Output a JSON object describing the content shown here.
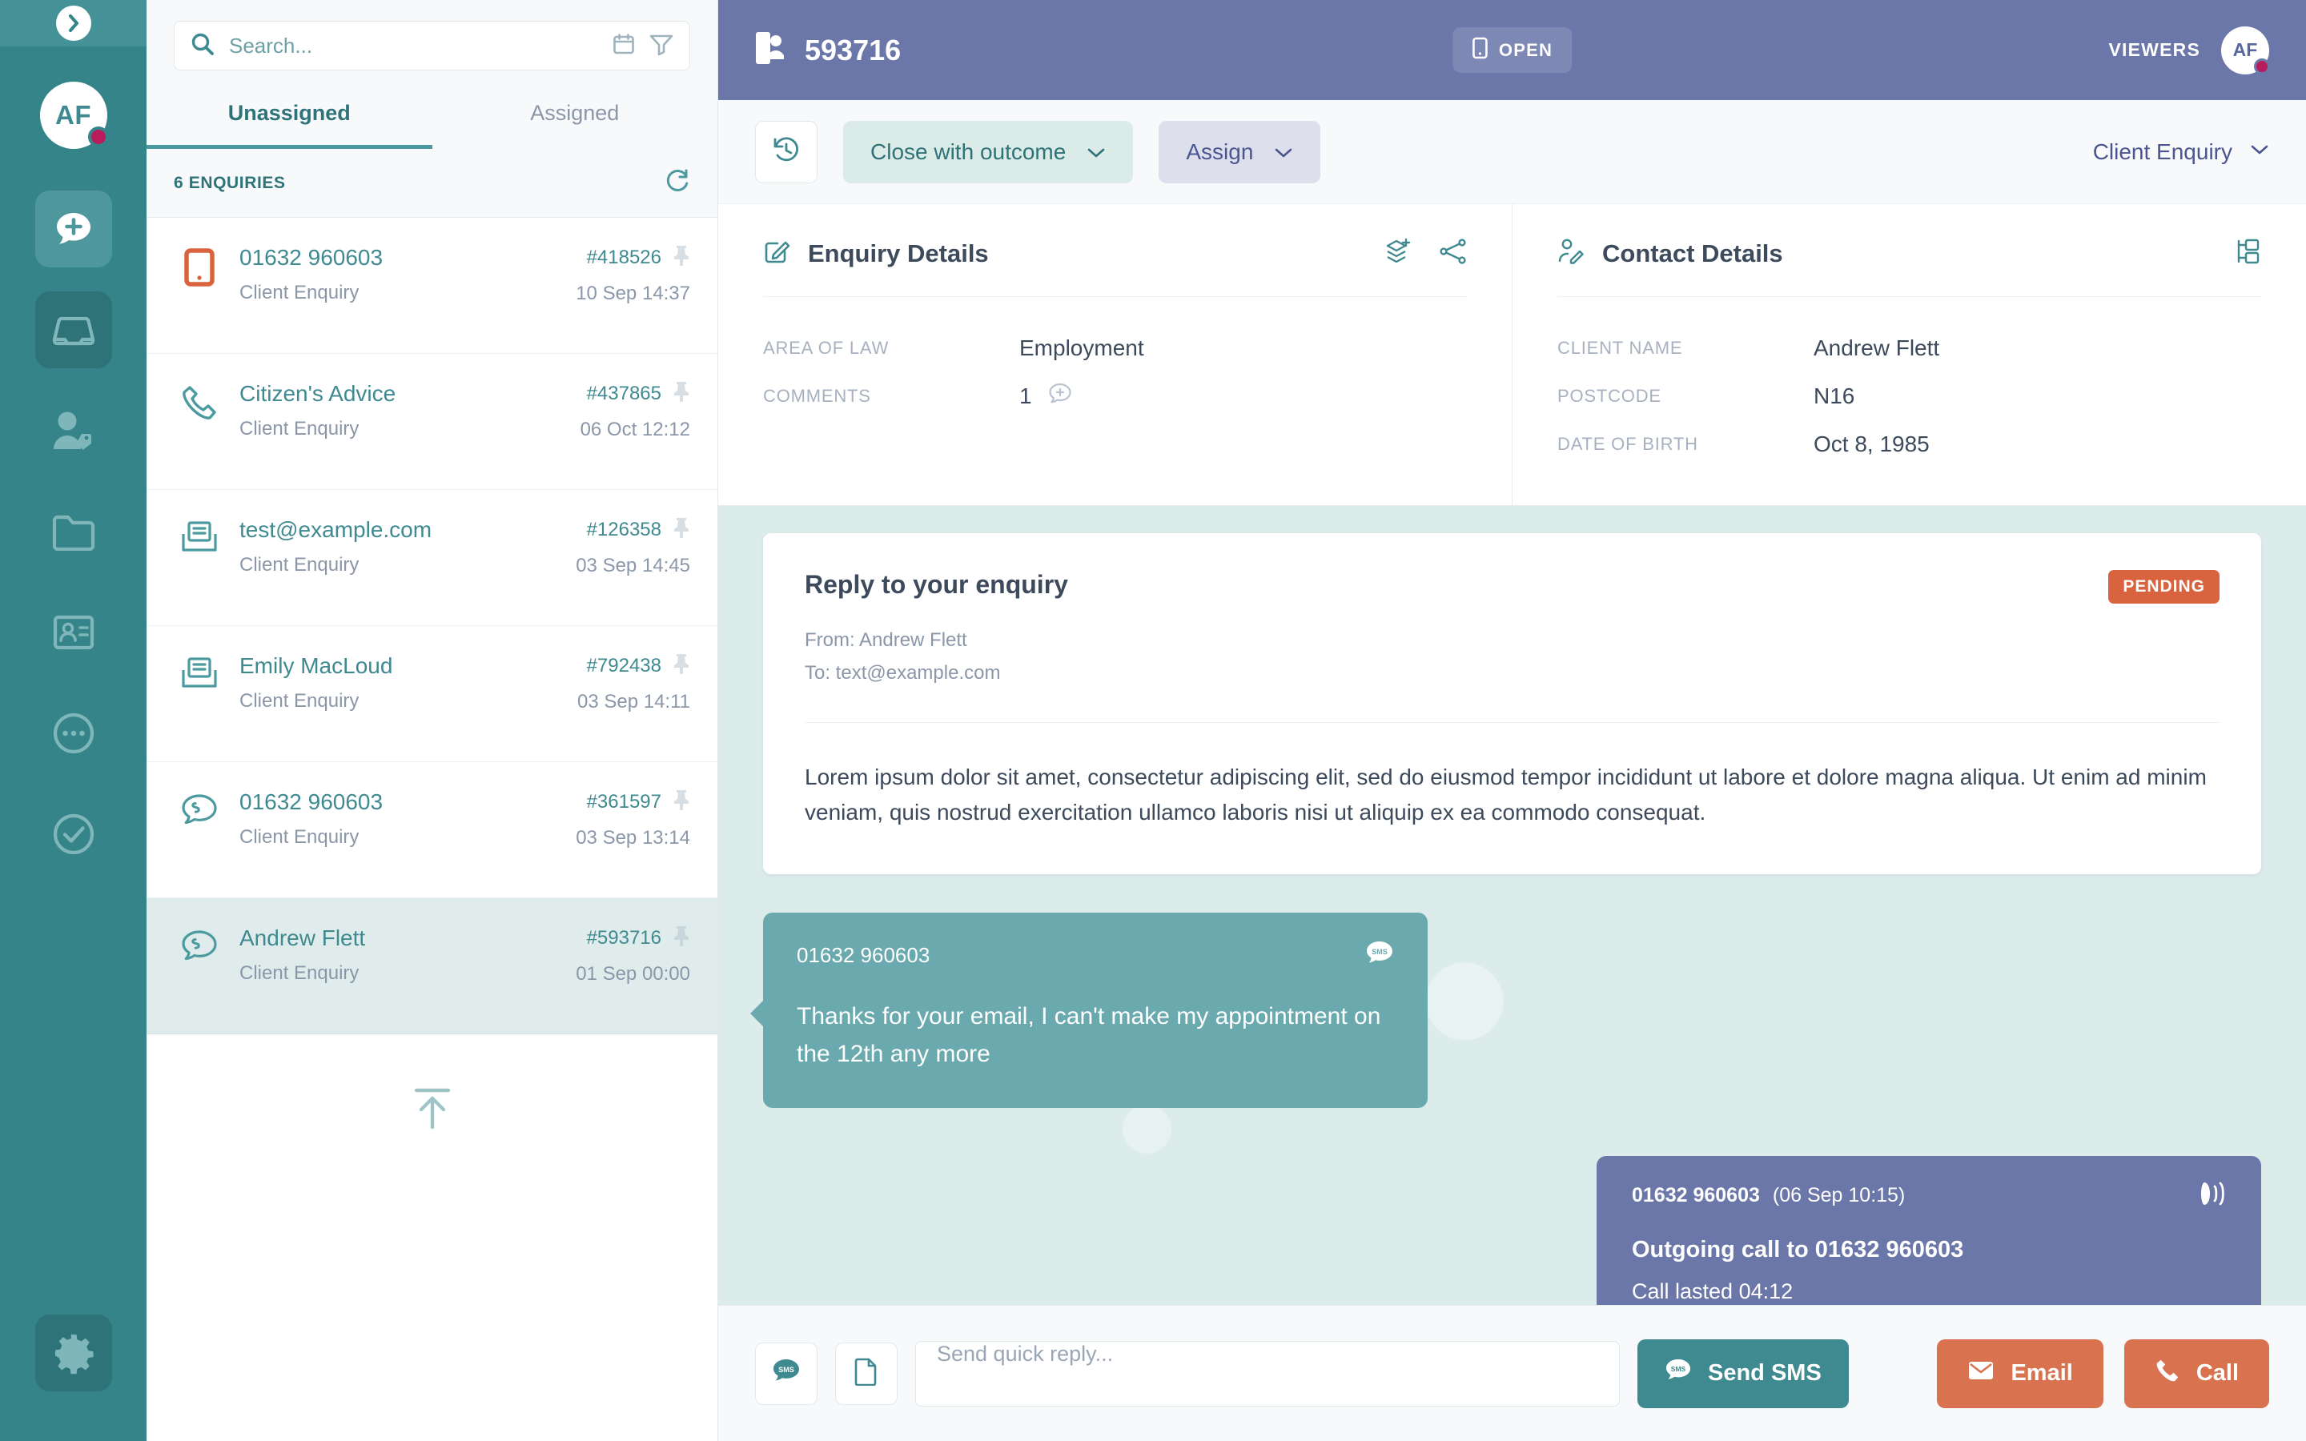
{
  "rail": {
    "collapse_icon": "chevron-right-icon",
    "avatar_initials": "AF",
    "items": [
      {
        "name": "new-enquiry",
        "icon": "chat-plus-icon",
        "active": false
      },
      {
        "name": "inbox",
        "icon": "inbox-tray-icon",
        "active": true
      },
      {
        "name": "contacts-tags",
        "icon": "person-tag-icon",
        "active": false
      },
      {
        "name": "folders",
        "icon": "folder-icon",
        "active": false
      },
      {
        "name": "contact-card",
        "icon": "contact-card-icon",
        "active": false
      },
      {
        "name": "more",
        "icon": "ellipsis-circle-icon",
        "active": false
      },
      {
        "name": "completed",
        "icon": "check-circle-icon",
        "active": false
      }
    ],
    "settings_icon": "gear-icon"
  },
  "list": {
    "search_placeholder": "Search...",
    "search_value": "",
    "search_icon": "search-icon",
    "calendar_icon": "calendar-icon",
    "filter_icon": "filter-funnel-icon",
    "refresh_icon": "refresh-icon",
    "tabs": [
      {
        "label": "Unassigned",
        "active": true
      },
      {
        "label": "Assigned",
        "active": false
      }
    ],
    "count_label": "6 ENQUIRIES",
    "upload_icon": "upload-arrow-icon",
    "rows": [
      {
        "icon": "mobile-phone-icon",
        "icon_color": "#d9633f",
        "title": "01632 960603",
        "subtitle": "Client Enquiry",
        "id": "#418526",
        "date": "10 Sep 14:37",
        "pin_icon": "pin-icon",
        "selected": false
      },
      {
        "icon": "phone-handset-icon",
        "icon_color": "#4b9aa0",
        "title": "Citizen's Advice",
        "subtitle": "Client Enquiry",
        "id": "#437865",
        "date": "06 Oct 12:12",
        "pin_icon": "pin-icon",
        "selected": false
      },
      {
        "icon": "open-envelope-icon",
        "icon_color": "#4b9aa0",
        "title": "test@example.com",
        "subtitle": "Client Enquiry",
        "id": "#126358",
        "date": "03 Sep 14:45",
        "pin_icon": "pin-icon",
        "selected": false
      },
      {
        "icon": "open-envelope-icon",
        "icon_color": "#4b9aa0",
        "title": "Emily MacLoud",
        "subtitle": "Client Enquiry",
        "id": "#792438",
        "date": "03 Sep 14:11",
        "pin_icon": "pin-icon",
        "selected": false
      },
      {
        "icon": "sms-chat-icon",
        "icon_color": "#4b9aa0",
        "title": "01632 960603",
        "subtitle": "Client Enquiry",
        "id": "#361597",
        "date": "03 Sep 13:14",
        "pin_icon": "pin-icon",
        "selected": false
      },
      {
        "icon": "sms-chat-icon",
        "icon_color": "#4b9aa0",
        "title": "Andrew Flett",
        "subtitle": "Client Enquiry",
        "id": "#593716",
        "date": "01 Sep 00:00",
        "pin_icon": "pin-icon",
        "selected": true
      }
    ]
  },
  "header": {
    "case_icon": "mobile-contact-icon",
    "case_number": "593716",
    "status_icon": "mobile-phone-icon",
    "status_label": "OPEN",
    "viewers_label": "VIEWERS",
    "viewer_initials": "AF"
  },
  "toolbar": {
    "history_icon": "history-clock-icon",
    "close_outcome_label": "Close with outcome",
    "assign_label": "Assign",
    "chevron_icon": "chevron-down-icon",
    "enquiry_type_label": "Client Enquiry"
  },
  "enquiry_details": {
    "icon": "edit-pencil-icon",
    "title": "Enquiry Details",
    "action_icons": [
      "add-layers-icon",
      "share-nodes-icon"
    ],
    "fields": [
      {
        "label": "AREA OF LAW",
        "value": "Employment",
        "trailing_icon": ""
      },
      {
        "label": "COMMENTS",
        "value": "1",
        "trailing_icon": "comment-plus-icon"
      }
    ]
  },
  "contact_details": {
    "icon": "person-edit-icon",
    "title": "Contact Details",
    "action_icons": [
      "org-chart-icon"
    ],
    "fields": [
      {
        "label": "CLIENT NAME",
        "value": "Andrew Flett"
      },
      {
        "label": "POSTCODE",
        "value": "N16"
      },
      {
        "label": "DATE OF BIRTH",
        "value": "Oct 8, 1985"
      }
    ]
  },
  "thread": {
    "email": {
      "subject": "Reply to your enquiry",
      "badge": "PENDING",
      "from": "From: Andrew Flett",
      "to": "To: text@example.com",
      "body": "Lorem ipsum dolor sit amet, consectetur adipiscing elit, sed do eiusmod tempor incididunt ut labore et dolore magna aliqua. Ut enim ad minim veniam, quis nostrud exercitation ullamco laboris nisi ut aliquip ex ea commodo consequat."
    },
    "sms": {
      "phone": "01632 960603",
      "icon": "sms-badge-icon",
      "text": "Thanks for your email, I can't make my appointment on the 12th any more"
    },
    "call": {
      "phone": "01632 960603",
      "timestamp": "(06 Sep 10:15)",
      "icon": "phone-ring-icon",
      "line1": "Outgoing call to 01632 960603",
      "line2": "Call lasted 04:12"
    }
  },
  "composer": {
    "sms_icon": "sms-badge-icon",
    "template_icon": "document-icon",
    "placeholder": "Send quick reply...",
    "value": "",
    "send_icon": "sms-badge-icon",
    "send_label": "Send SMS",
    "email_icon": "envelope-icon",
    "email_label": "Email",
    "call_icon": "phone-handset-icon",
    "call_label": "Call"
  },
  "colors": {
    "teal": "#348489",
    "teal_dark": "#2e7378",
    "accent_purple": "#6b77a8",
    "orange": "#d9734f",
    "pending": "#d9633f",
    "bubble": "#6aa9ad",
    "pink_dot": "#b91c5c"
  }
}
